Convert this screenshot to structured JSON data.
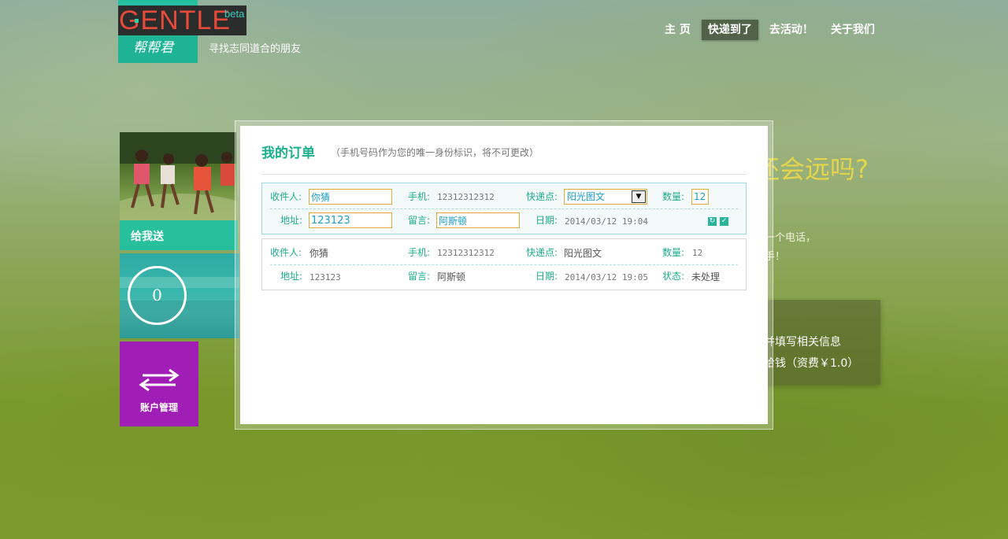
{
  "brand": {
    "logo_word": "GENTLE",
    "logo_beta": "beta",
    "logo_cn": "帮帮君",
    "slogan": "寻找志同道合的朋友"
  },
  "nav": {
    "items": [
      {
        "label": "主 页",
        "active": false
      },
      {
        "label": "快递到了",
        "active": true
      },
      {
        "label": "去活动！",
        "active": false
      },
      {
        "label": "关于我们",
        "active": false
      }
    ]
  },
  "background": {
    "title_fragment": "还会远吗?",
    "line1": "您一个电话，",
    "line2": "到手！",
    "box_line1": "并填写相关信息",
    "box_line2": "给钱（资费￥1.0）"
  },
  "sidebar": {
    "photo_tile_label": "给我送",
    "counter_value": "0",
    "account_label": "账户管理"
  },
  "panel": {
    "title": "我的订单",
    "note": "（手机号码作为您的唯一身份标识，将不可更改）",
    "labels": {
      "recipient": "收件人:",
      "phone": "手机:",
      "pickup": "快递点:",
      "quantity": "数量:",
      "address": "地址:",
      "message": "留言:",
      "date": "日期:",
      "status": "状态:"
    },
    "editing_order": {
      "recipient": "你猜",
      "phone": "12312312312",
      "pickup": "阳光图文",
      "quantity": "12",
      "address": "123123",
      "message": "阿斯顿",
      "date": "2014/03/12 19:04"
    },
    "orders": [
      {
        "recipient": "你猜",
        "phone": "12312312312",
        "pickup": "阳光图文",
        "quantity": "12",
        "address": "123123",
        "message": "阿斯顿",
        "date": "2014/03/12 19:05",
        "status": "未处理"
      }
    ]
  },
  "colors": {
    "accent": "#1eae8d",
    "account_tile": "#a11eb6",
    "nav_active": "#46553c"
  }
}
